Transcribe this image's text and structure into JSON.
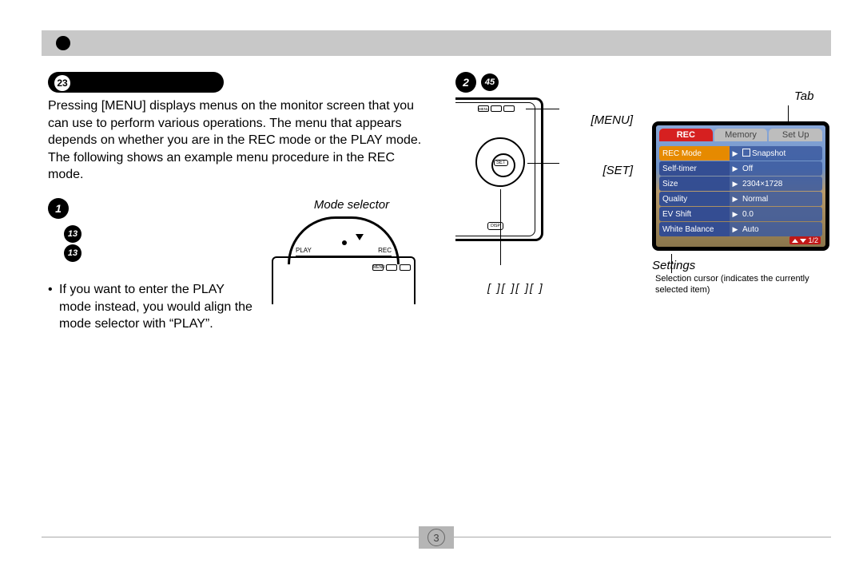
{
  "header": {
    "section_number": "23"
  },
  "intro_text": "Pressing [MENU] displays menus on the monitor screen that you can use to perform various operations. The menu that appears depends on whether you are in the REC mode or the PLAY mode. The following shows an example menu procedure in the REC mode.",
  "step1": {
    "circle": "1",
    "sub_a": "13",
    "sub_b": "13",
    "mode_selector_label": "Mode selector",
    "diagram": {
      "left_label": "PLAY",
      "right_label": "REC",
      "menu_btn": "MENU"
    },
    "bullet_text": "If you want to enter the PLAY mode instead, you would align the mode selector with “PLAY”."
  },
  "step2": {
    "circle_a": "2",
    "circle_b": "45",
    "labels": {
      "menu": "[MENU]",
      "set": "[SET]"
    },
    "diagram_btns": {
      "menu": "MENU",
      "set": "SET",
      "disp": "DISP"
    },
    "brackets": "[   ][   ][   ][   ]",
    "tab_label": "Tab",
    "tabs": [
      "REC",
      "Memory",
      "Set Up"
    ],
    "menu_rows": [
      {
        "name": "REC Mode",
        "value": "Snapshot",
        "selected": true
      },
      {
        "name": "Self-timer",
        "value": "Off",
        "selected": false
      },
      {
        "name": "Size",
        "value": "2304×1728",
        "selected": false
      },
      {
        "name": "Quality",
        "value": "Normal",
        "selected": false
      },
      {
        "name": "EV Shift",
        "value": "0.0",
        "selected": false
      },
      {
        "name": "White Balance",
        "value": "Auto",
        "selected": false
      }
    ],
    "page_indicator": "1/2",
    "settings_label": "Settings",
    "settings_note": "Selection cursor (indicates the currently selected item)"
  },
  "footer": {
    "page": "3"
  }
}
